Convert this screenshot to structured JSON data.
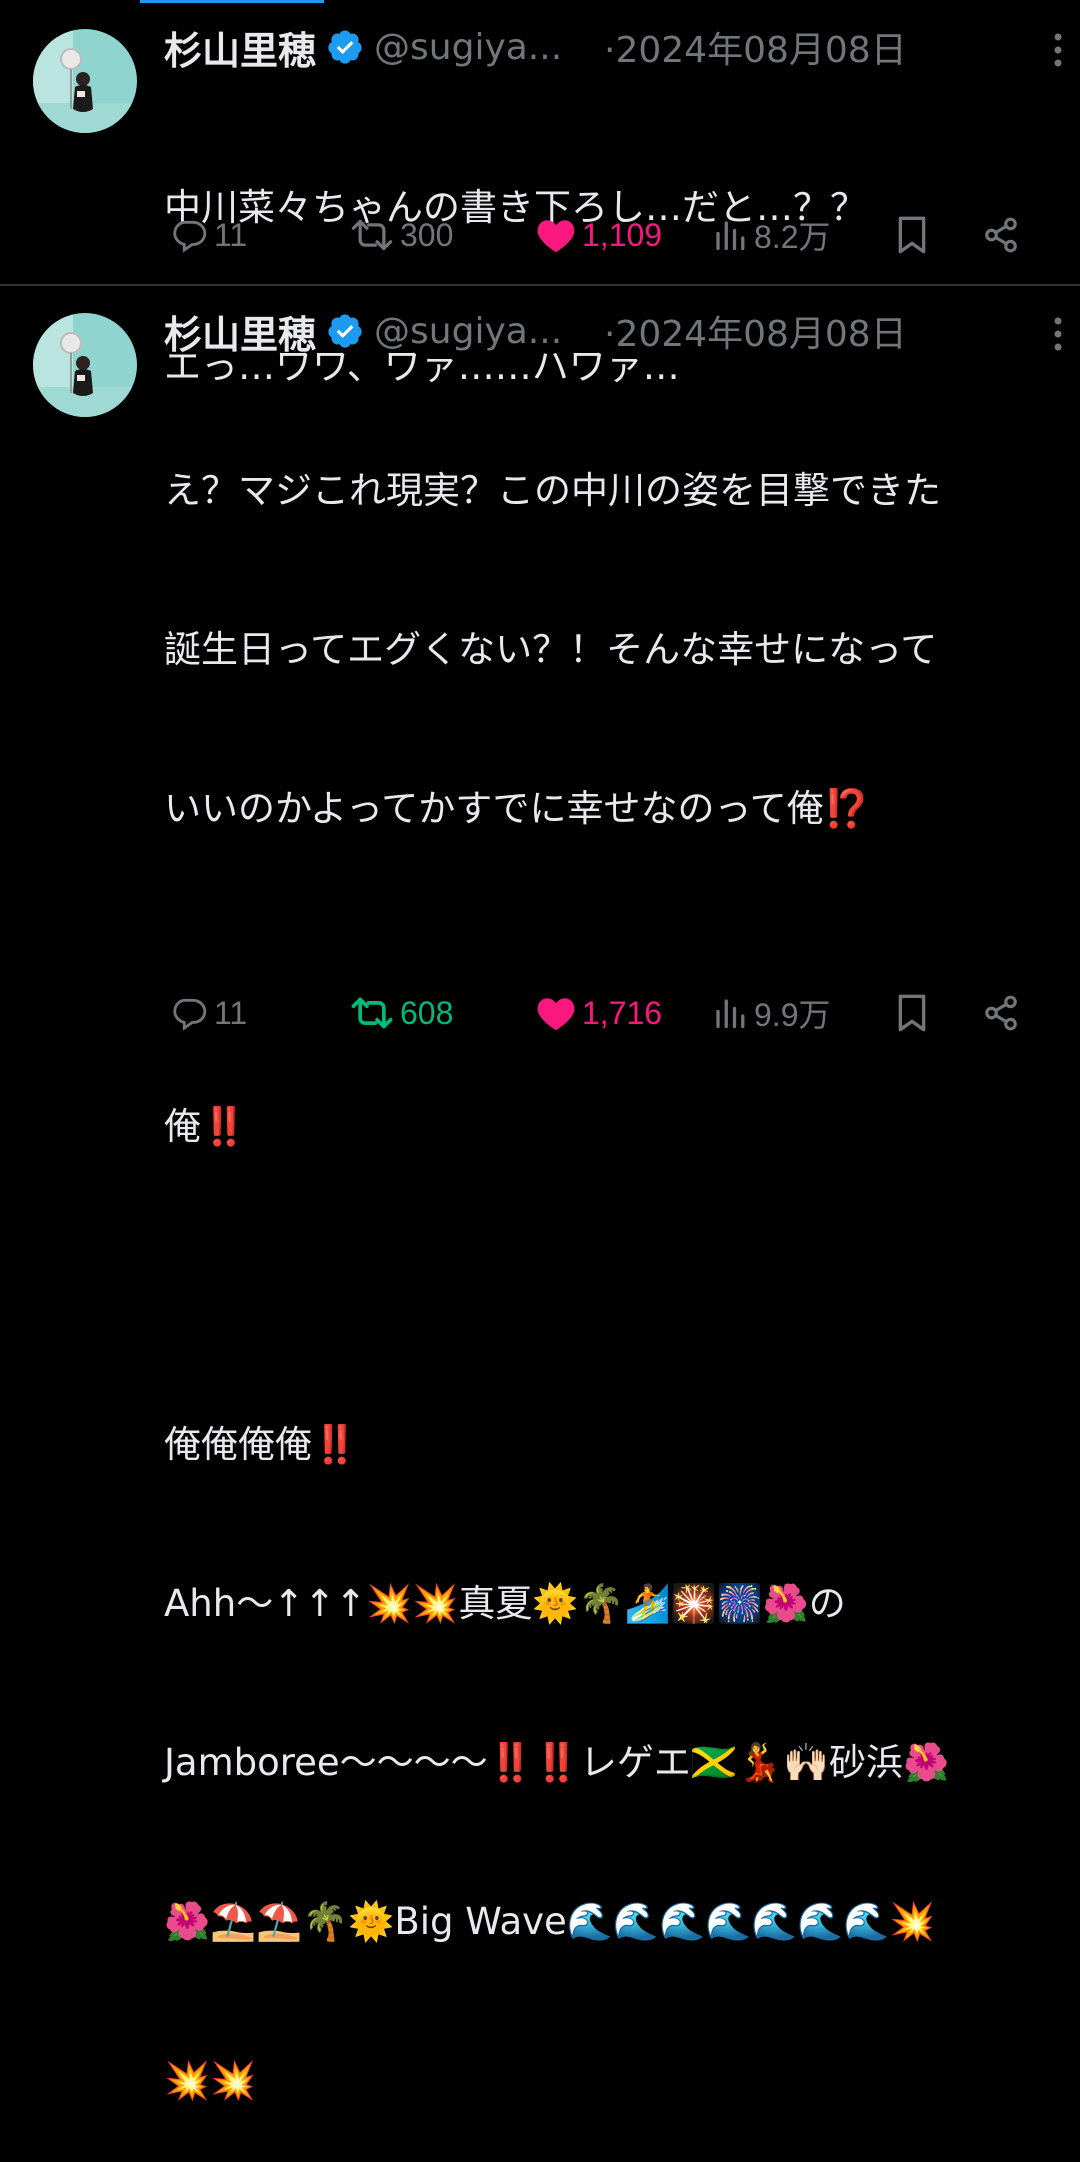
{
  "colors": {
    "background": "#000000",
    "text": "#e7e9ea",
    "muted": "#71767b",
    "verified": "#1d9bf0",
    "like_active": "#f91880",
    "retweet_active": "#00ba7c",
    "divider": "#2f3336"
  },
  "tweets": [
    {
      "author": {
        "name": "杉山里穂",
        "handle": "@sugiya...",
        "verified": true,
        "avatar_icon": "avatar-photo-icon"
      },
      "separator": "·",
      "date": "2024年08月08日",
      "text_lines": [
        "中川菜々ちゃんの書き下ろし…だと…？？",
        "エっ…ワワ、ワァ……ハワァ…"
      ],
      "stats": {
        "replies": "11",
        "retweets": "300",
        "likes": "1,109",
        "views": "8.2万",
        "liked": true,
        "retweeted": false
      }
    },
    {
      "author": {
        "name": "杉山里穂",
        "handle": "@sugiya...",
        "verified": true,
        "avatar_icon": "avatar-photo-icon"
      },
      "separator": "·",
      "date": "2024年08月08日",
      "text_lines": [
        "え？マジこれ現実？この中川の姿を目撃できた",
        "誕生日ってエグくない？！そんな幸せになって",
        "いいのかよってかすでに幸せなのって俺⁉️",
        "",
        "俺‼️",
        "",
        "俺俺俺俺‼️",
        "Ahh〜↑↑↑💥💥真夏🌞🌴🏄🎇🎆🌺の",
        "Jamboree〜〜〜〜‼️‼️レゲエ🇯🇲💃🙌🏻砂浜🌺",
        "🌺⛱️⛱️🌴🌞Big Wave🌊🌊🌊🌊🌊🌊🌊💥",
        "💥💥"
      ],
      "stats": {
        "replies": "11",
        "retweets": "608",
        "likes": "1,716",
        "views": "9.9万",
        "liked": true,
        "retweeted": true
      }
    }
  ],
  "icons": {
    "reply": "reply-icon",
    "retweet": "retweet-icon",
    "like": "heart-icon",
    "views": "views-icon",
    "bookmark": "bookmark-icon",
    "share": "share-icon",
    "more": "more-options-icon",
    "verified": "verified-badge-icon"
  }
}
